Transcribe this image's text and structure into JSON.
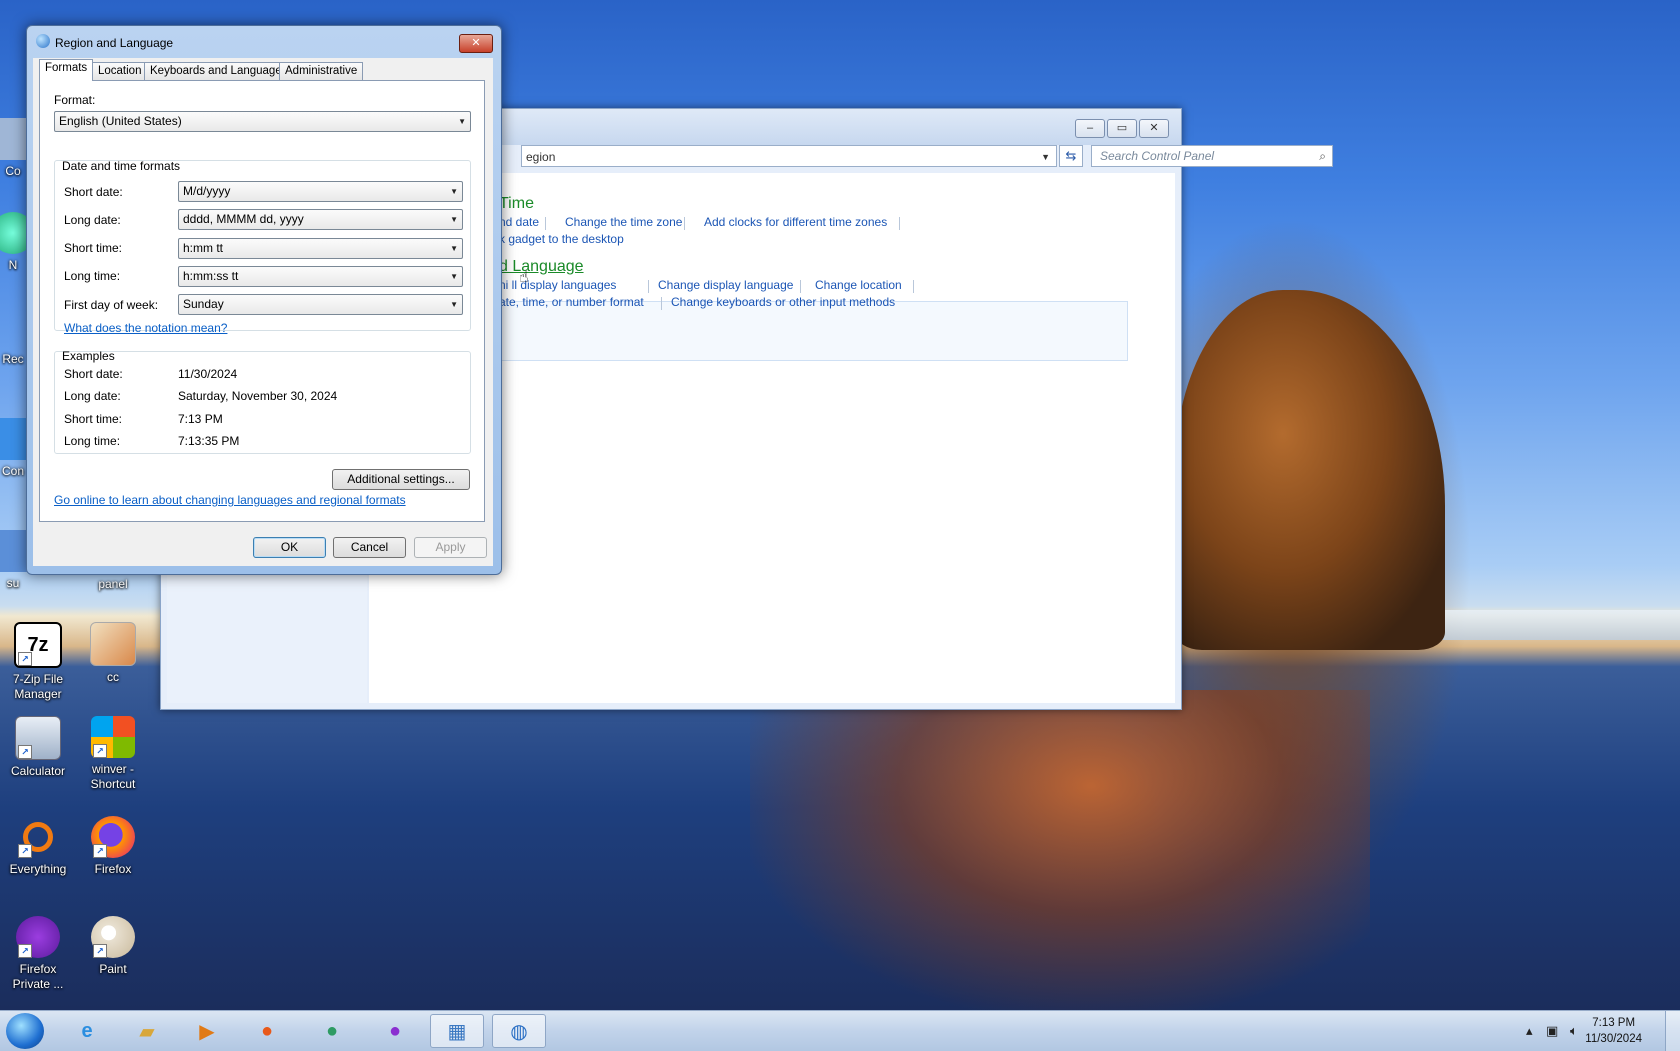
{
  "desktop": {
    "icons": [
      {
        "label": "Co"
      },
      {
        "label": "N"
      },
      {
        "label": "Rec"
      },
      {
        "label": "Con"
      },
      {
        "label": "su"
      },
      {
        "label": "panel"
      },
      {
        "label": "7-Zip File Manager"
      },
      {
        "label": "cc"
      },
      {
        "label": "Calculator"
      },
      {
        "label": "winver - Shortcut"
      },
      {
        "label": "Everything"
      },
      {
        "label": "Firefox"
      },
      {
        "label": "Firefox Private ..."
      },
      {
        "label": "Paint"
      }
    ]
  },
  "control_panel": {
    "address": "egion",
    "search_placeholder": "Search Control Panel",
    "sections": [
      {
        "heading": "Time",
        "links": [
          "nd date",
          "Change the time zone",
          "Add clocks for different time zones"
        ],
        "links2": [
          "k gadget to the desktop"
        ]
      },
      {
        "heading": "d Language",
        "links": [
          "ni    ll display languages",
          "Change display language",
          "Change location"
        ],
        "links2": [
          "ate, time, or number format",
          "Change keyboards or other input methods"
        ]
      }
    ]
  },
  "dialog": {
    "title": "Region and Language",
    "close_label": "✕",
    "tabs": [
      "Formats",
      "Location",
      "Keyboards and Languages",
      "Administrative"
    ],
    "format_label": "Format:",
    "format_value": "English (United States)",
    "dt_group_label": "Date and time formats",
    "fields": [
      {
        "label": "Short date:",
        "value": "M/d/yyyy"
      },
      {
        "label": "Long date:",
        "value": "dddd, MMMM dd, yyyy"
      },
      {
        "label": "Short time:",
        "value": "h:mm tt"
      },
      {
        "label": "Long time:",
        "value": "h:mm:ss tt"
      },
      {
        "label": "First day of week:",
        "value": "Sunday"
      }
    ],
    "notation_link": "What does the notation mean?",
    "examples_label": "Examples",
    "examples": [
      {
        "label": "Short date:",
        "value": "11/30/2024"
      },
      {
        "label": "Long date:",
        "value": "Saturday, November 30, 2024"
      },
      {
        "label": "Short time:",
        "value": "7:13 PM"
      },
      {
        "label": "Long time:",
        "value": "7:13:35 PM"
      }
    ],
    "additional_button": "Additional settings...",
    "online_link": "Go online to learn about changing languages and regional formats",
    "ok_button": "OK",
    "cancel_button": "Cancel",
    "apply_button": "Apply"
  },
  "taskbar": {
    "clock_time": "7:13 PM",
    "clock_date": "11/30/2024"
  }
}
